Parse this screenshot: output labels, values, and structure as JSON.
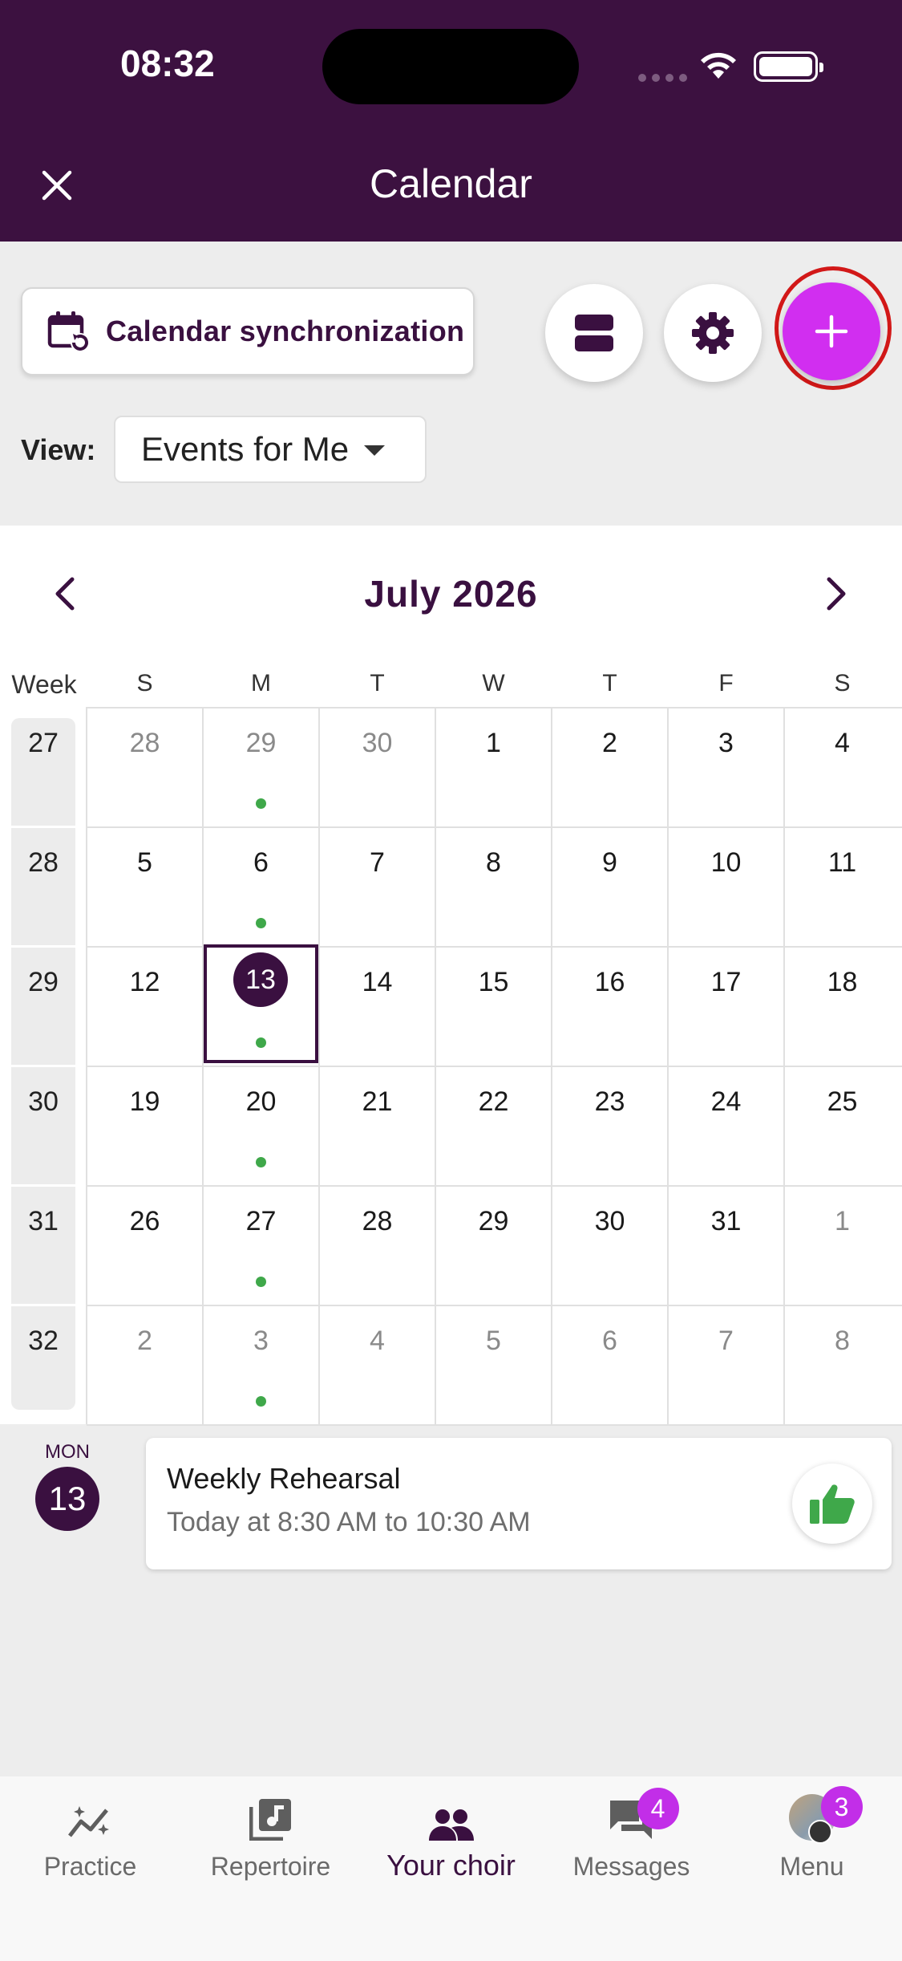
{
  "status_bar": {
    "time": "08:32"
  },
  "header": {
    "title": "Calendar"
  },
  "toolbar": {
    "sync_label": "Calendar synchronization"
  },
  "view": {
    "label": "View:",
    "selected": "Events for Me"
  },
  "calendar": {
    "month_title": "July 2026",
    "week_header": "Week",
    "weekdays": [
      "S",
      "M",
      "T",
      "W",
      "T",
      "F",
      "S"
    ],
    "weeks": [
      {
        "num": "27",
        "days": [
          "28",
          "29",
          "30",
          "1",
          "2",
          "3",
          "4"
        ]
      },
      {
        "num": "28",
        "days": [
          "5",
          "6",
          "7",
          "8",
          "9",
          "10",
          "11"
        ]
      },
      {
        "num": "29",
        "days": [
          "12",
          "13",
          "14",
          "15",
          "16",
          "17",
          "18"
        ]
      },
      {
        "num": "30",
        "days": [
          "19",
          "20",
          "21",
          "22",
          "23",
          "24",
          "25"
        ]
      },
      {
        "num": "31",
        "days": [
          "26",
          "27",
          "28",
          "29",
          "30",
          "31",
          "1"
        ]
      },
      {
        "num": "32",
        "days": [
          "2",
          "3",
          "4",
          "5",
          "6",
          "7",
          "8"
        ]
      }
    ],
    "today": "13"
  },
  "event": {
    "day_label": "MON",
    "day_num": "13",
    "title": "Weekly Rehearsal",
    "time": "Today at 8:30 AM to 10:30 AM"
  },
  "bottom_nav": {
    "practice": "Practice",
    "repertoire": "Repertoire",
    "choir": "Your choir",
    "messages": "Messages",
    "messages_badge": "4",
    "menu": "Menu",
    "menu_badge": "3"
  },
  "colors": {
    "brand": "#3c1140",
    "accent": "#d12ef0",
    "event_dot": "#3fa84a"
  }
}
